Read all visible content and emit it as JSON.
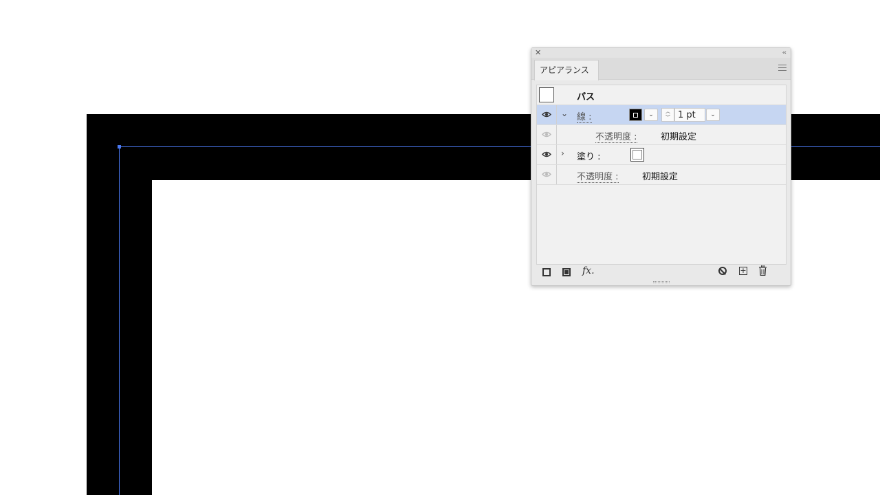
{
  "panel": {
    "close_icon": "close-icon",
    "collapse_icon": "collapse-icon",
    "tab_label": "アピアランス",
    "menu_icon": "panel-menu-icon"
  },
  "rows": {
    "path_title": "パス",
    "stroke": {
      "label": "線 :",
      "swatch_color": "#000000",
      "weight": "1 pt",
      "opacity_label": "不透明度 :",
      "opacity_value": "初期設定"
    },
    "fill": {
      "label": "塗り :",
      "swatch_color": "#ffffff"
    },
    "object_opacity": {
      "label": "不透明度 :",
      "value": "初期設定"
    }
  },
  "footer": {
    "fx_label": "fx."
  },
  "colors": {
    "selection": "#c6d6f2",
    "guide": "#4a78f0"
  }
}
